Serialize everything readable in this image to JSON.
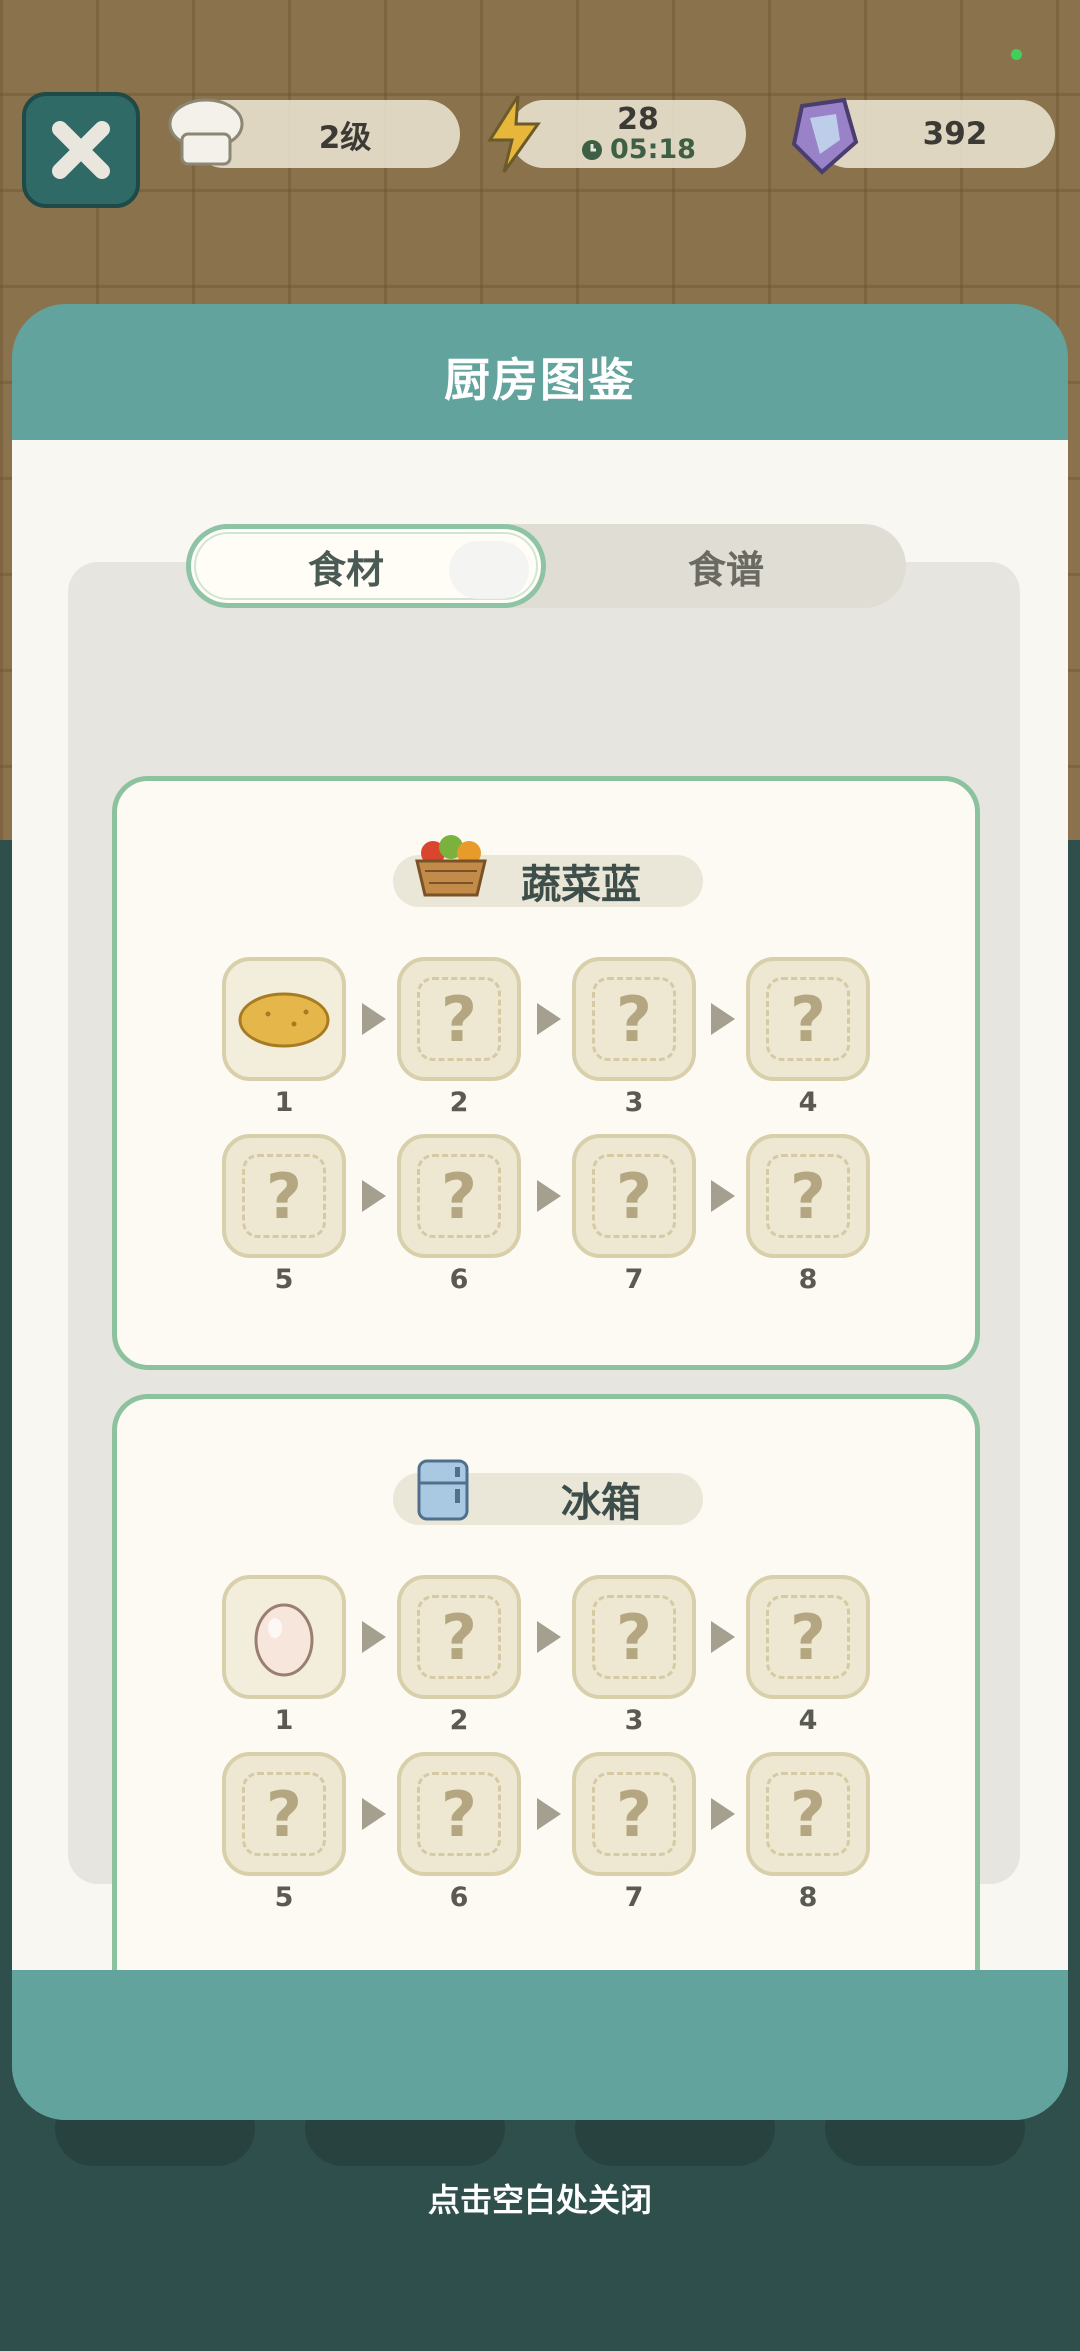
{
  "hud": {
    "level_label": "2级",
    "energy_value": "28",
    "energy_timer": "05:18",
    "gem_value": "392",
    "icons": [
      "close-icon",
      "chef-hat-icon",
      "lightning-icon",
      "clock-icon",
      "gem-icon"
    ]
  },
  "modal": {
    "title": "厨房图鉴",
    "tabs": [
      {
        "label": "食材",
        "active": true
      },
      {
        "label": "食谱",
        "active": false
      }
    ],
    "sections": [
      {
        "name": "蔬菜蓝",
        "icon": "vegetable-basket-icon",
        "slots": [
          {
            "number": "1",
            "unlocked": true,
            "item_icon": "potato-icon"
          },
          {
            "number": "2",
            "unlocked": false,
            "placeholder": "?"
          },
          {
            "number": "3",
            "unlocked": false,
            "placeholder": "?"
          },
          {
            "number": "4",
            "unlocked": false,
            "placeholder": "?"
          },
          {
            "number": "5",
            "unlocked": false,
            "placeholder": "?"
          },
          {
            "number": "6",
            "unlocked": false,
            "placeholder": "?"
          },
          {
            "number": "7",
            "unlocked": false,
            "placeholder": "?"
          },
          {
            "number": "8",
            "unlocked": false,
            "placeholder": "?"
          }
        ]
      },
      {
        "name": "冰箱",
        "icon": "fridge-icon",
        "slots": [
          {
            "number": "1",
            "unlocked": true,
            "item_icon": "egg-icon"
          },
          {
            "number": "2",
            "unlocked": false,
            "placeholder": "?"
          },
          {
            "number": "3",
            "unlocked": false,
            "placeholder": "?"
          },
          {
            "number": "4",
            "unlocked": false,
            "placeholder": "?"
          },
          {
            "number": "5",
            "unlocked": false,
            "placeholder": "?"
          },
          {
            "number": "6",
            "unlocked": false,
            "placeholder": "?"
          },
          {
            "number": "7",
            "unlocked": false,
            "placeholder": "?"
          },
          {
            "number": "8",
            "unlocked": false,
            "placeholder": "?"
          }
        ]
      }
    ]
  },
  "hint": "点击空白处关闭",
  "colors": {
    "modal_teal": "#62a39d",
    "card_border": "#8dc29f",
    "panel_bg": "#f9f7f2"
  }
}
